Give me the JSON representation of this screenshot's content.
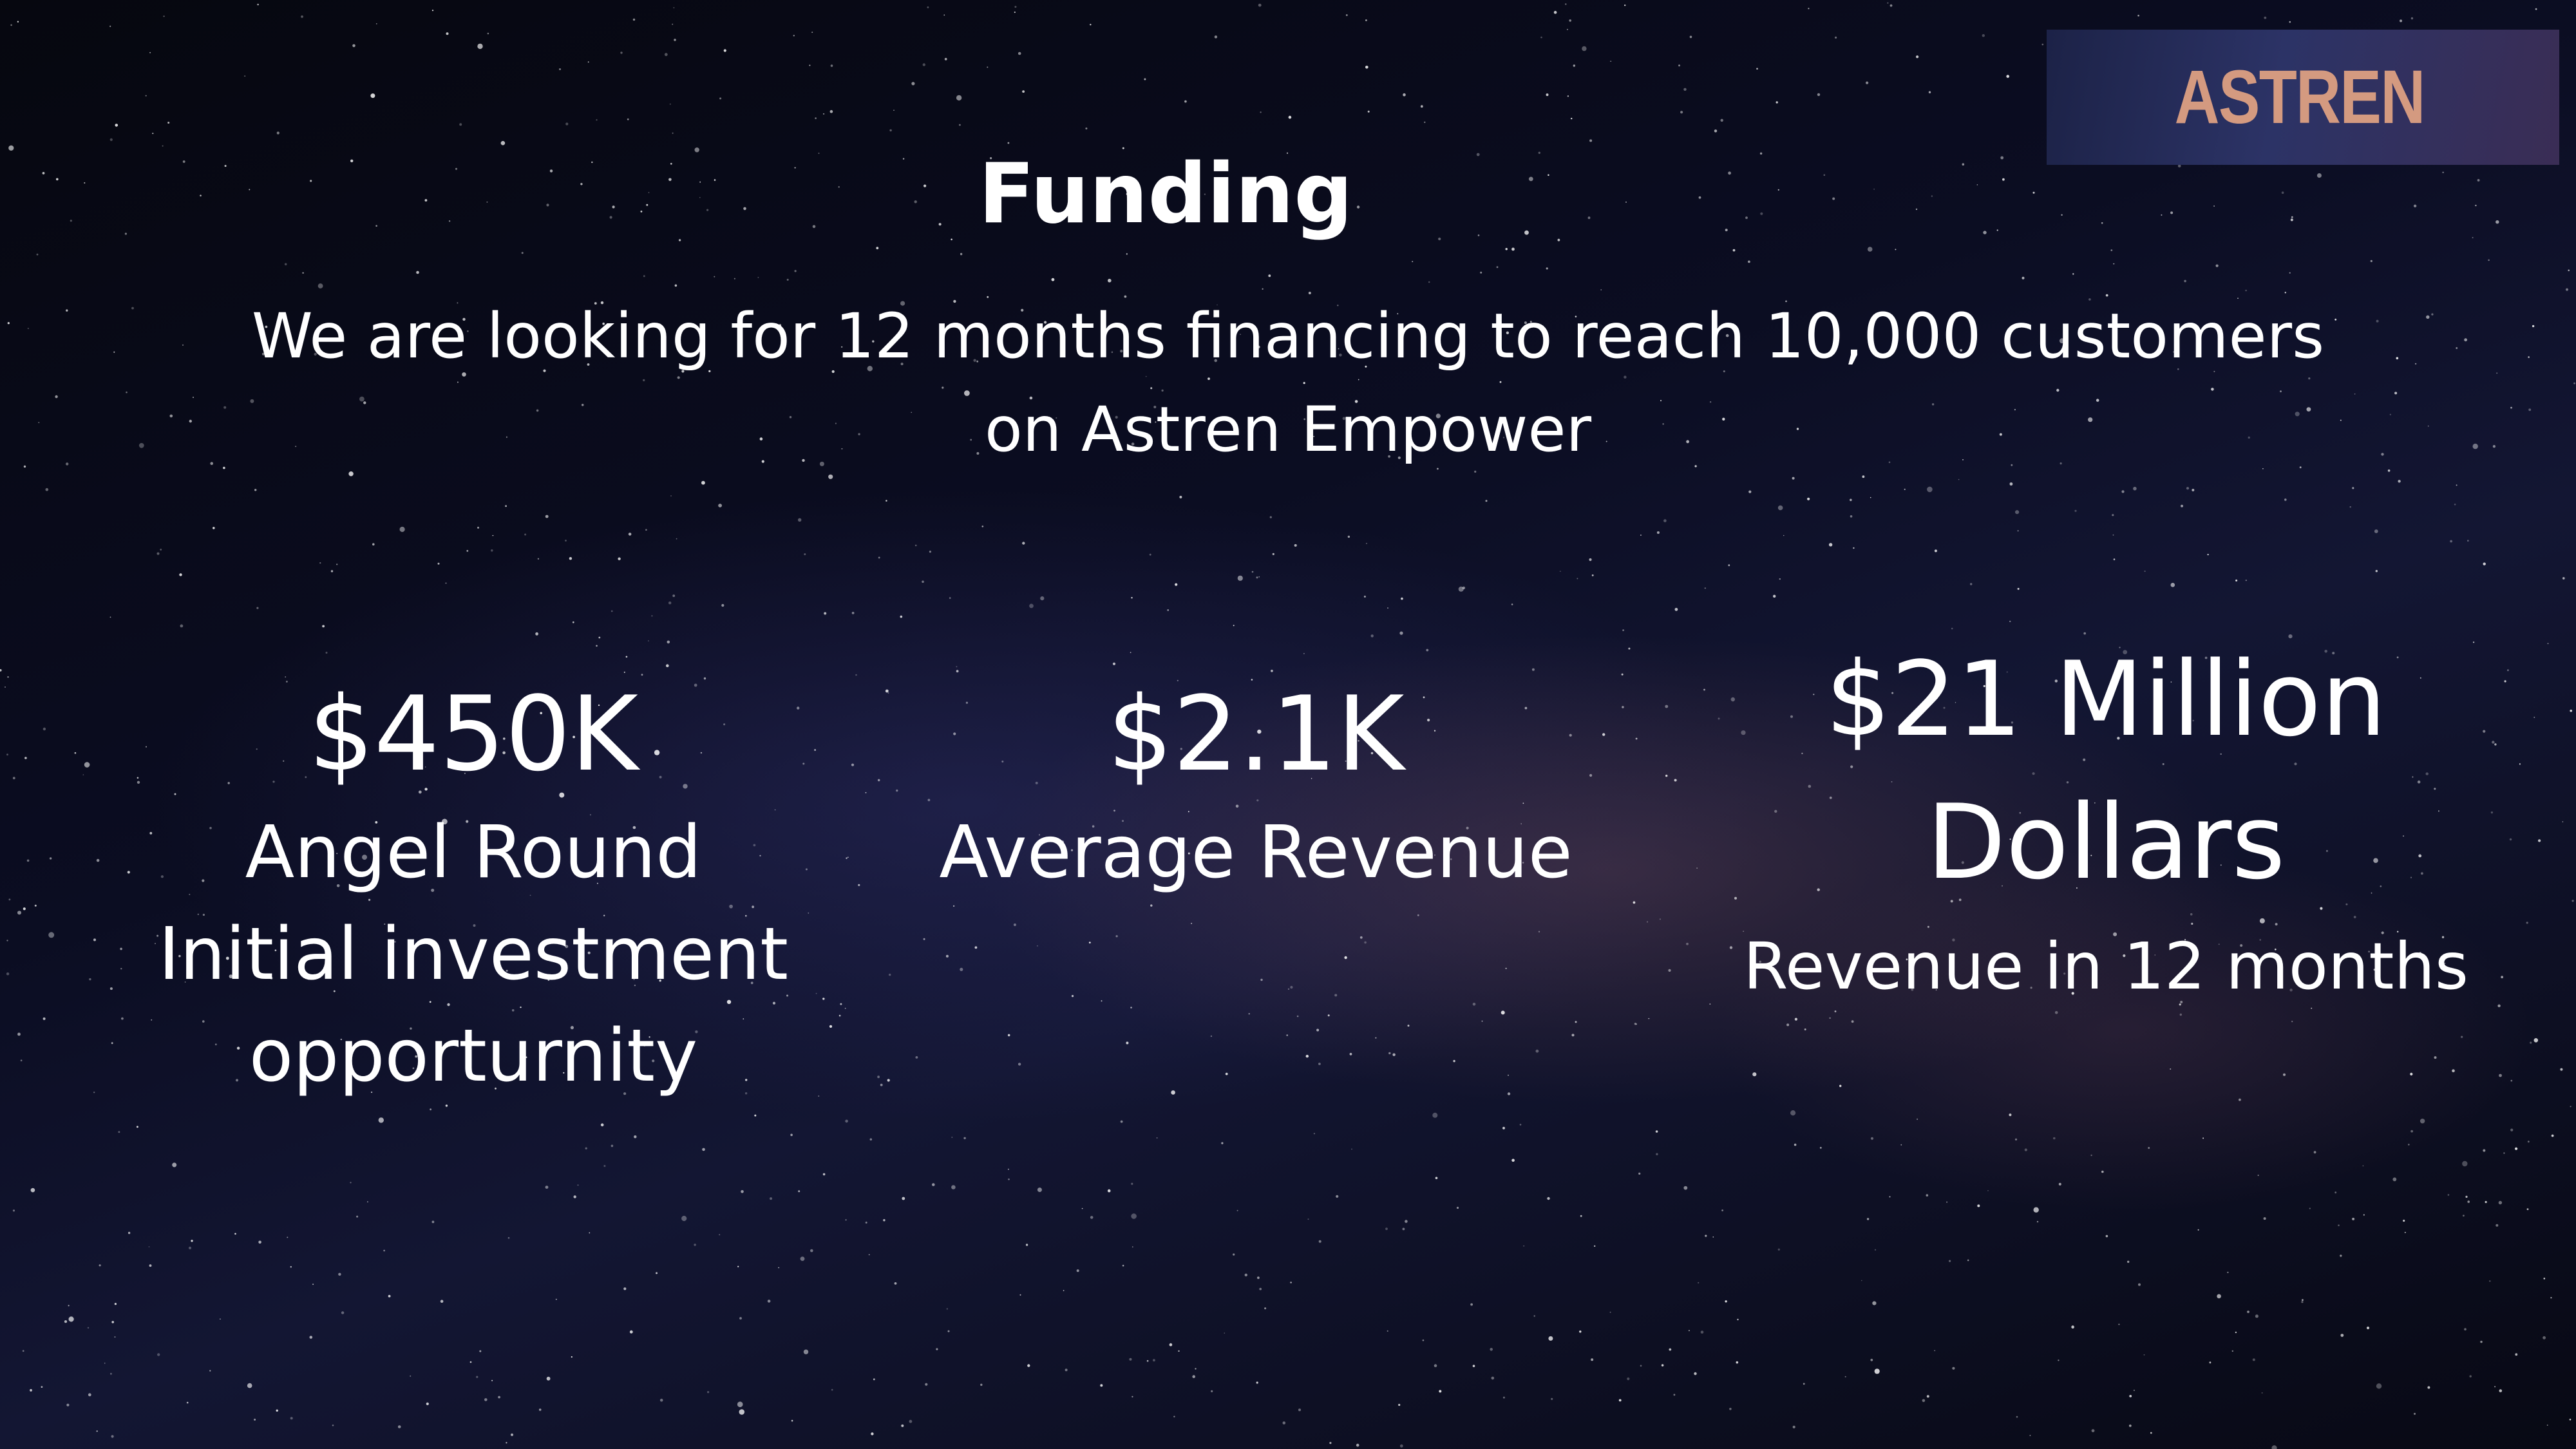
{
  "slide": {
    "logo": "ASTREN",
    "title": "Funding",
    "subtitle_line1": "We are looking for 12 months financing to reach 10,000 customers",
    "subtitle_line2": "on Astren Empower",
    "stats": [
      {
        "value": "$450K",
        "label_lines": [
          "Angel Round",
          "Initial investment",
          "opporturnity"
        ]
      },
      {
        "value": "$2.1K",
        "label_lines": [
          "Average Revenue"
        ]
      },
      {
        "value_lines": [
          "$21 Million",
          "Dollars"
        ],
        "label_lines": [
          "Revenue in 12 months"
        ]
      }
    ]
  },
  "colors": {
    "background": "#0b0d22",
    "text": "#ffffff",
    "logo_text": "#d49a80",
    "logo_bg": "#2c3366"
  }
}
